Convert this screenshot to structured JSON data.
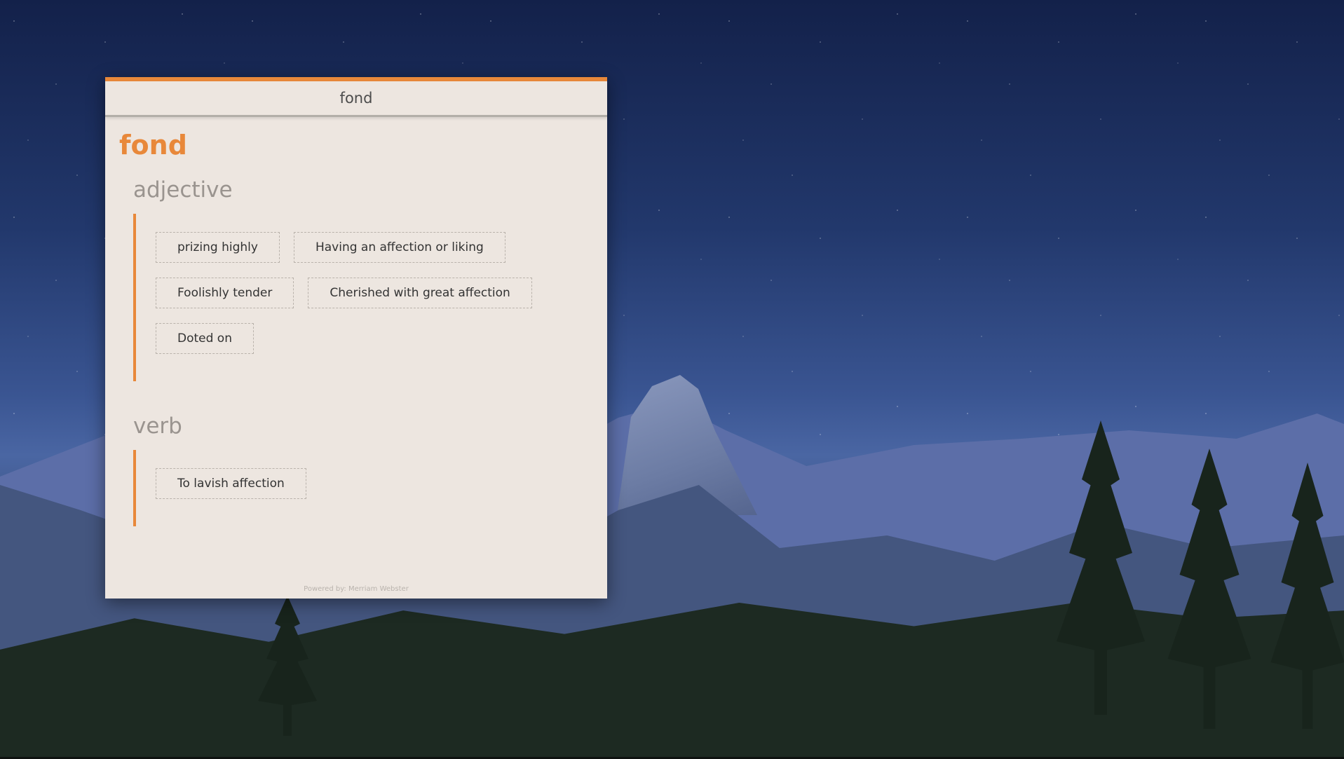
{
  "window": {
    "title": "fond",
    "accent_color": "#e8883a",
    "background_color": "#ede6e0"
  },
  "entry": {
    "word": "fond",
    "adjective": {
      "label": "adjective",
      "definitions": [
        "prizing highly",
        "Having an affection or liking",
        "Foolishly tender",
        "Cherished with great affection",
        "Doted on"
      ]
    },
    "verb": {
      "label": "verb",
      "definitions": [
        "To lavish affection"
      ]
    }
  },
  "footer": {
    "credit": "Powered by: Merriam Webster"
  }
}
